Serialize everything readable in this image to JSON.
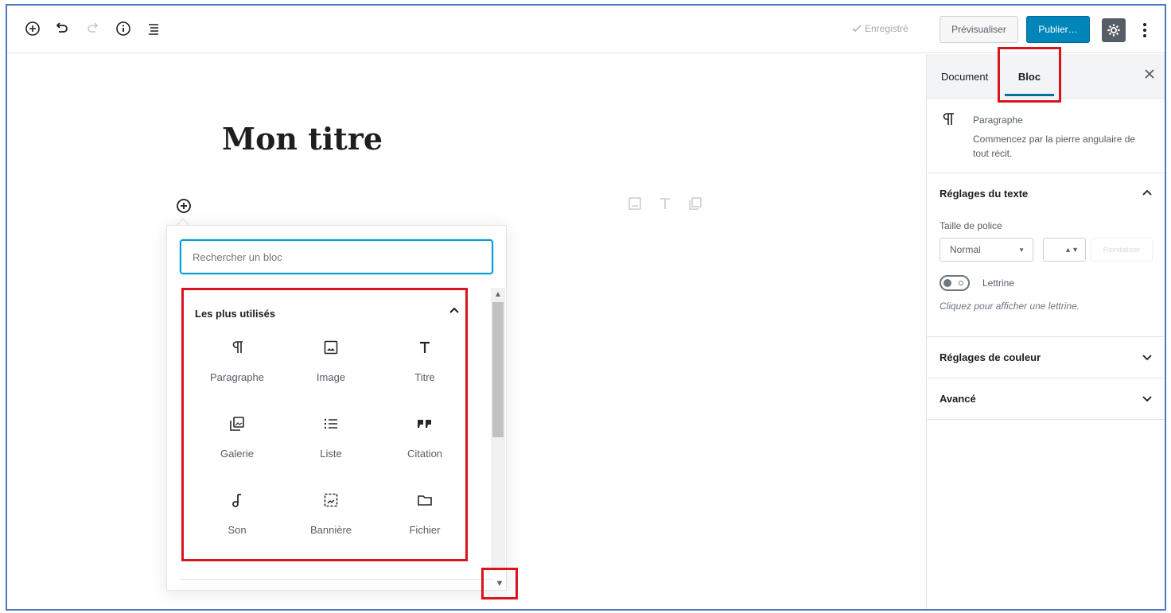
{
  "toolbar": {
    "add_icon": "plus-circle-icon",
    "undo_icon": "undo-icon",
    "redo_icon": "redo-icon",
    "info_icon": "info-icon",
    "outline_icon": "list-outline-icon",
    "saved_label": "Enregistré",
    "preview_label": "Prévisualiser",
    "publish_label": "Publier…",
    "settings_icon": "gear-icon",
    "more_icon": "vertical-ellipsis-icon"
  },
  "editor": {
    "post_title": "Mon titre",
    "hint_icons": [
      "image-icon",
      "heading-icon",
      "gallery-icon"
    ]
  },
  "inserter": {
    "search_placeholder": "Rechercher un bloc",
    "section_title": "Les plus utilisés",
    "blocks": [
      {
        "label": "Paragraphe",
        "icon": "paragraph-icon"
      },
      {
        "label": "Image",
        "icon": "image-icon"
      },
      {
        "label": "Titre",
        "icon": "heading-icon"
      },
      {
        "label": "Galerie",
        "icon": "gallery-icon"
      },
      {
        "label": "Liste",
        "icon": "list-icon"
      },
      {
        "label": "Citation",
        "icon": "quote-icon"
      },
      {
        "label": "Son",
        "icon": "audio-icon"
      },
      {
        "label": "Bannière",
        "icon": "cover-icon"
      },
      {
        "label": "Fichier",
        "icon": "folder-icon"
      }
    ]
  },
  "sidebar": {
    "tabs": {
      "document": "Document",
      "bloc": "Bloc"
    },
    "active_tab": "Bloc",
    "block_card": {
      "title": "Paragraphe",
      "description": "Commencez par la pierre angulaire de tout récit."
    },
    "text_settings": {
      "title": "Réglages du texte",
      "font_size_label": "Taille de police",
      "font_size_value": "Normal",
      "reset_label": "Réinitialiser",
      "drop_cap_label": "Lettrine",
      "drop_cap_help": "Cliquez pour afficher une lettrine."
    },
    "color_settings": {
      "title": "Réglages de couleur"
    },
    "advanced": {
      "title": "Avancé"
    }
  },
  "colors": {
    "accent": "#0085ba",
    "highlight": "#d9141b",
    "frame": "#4a78c2"
  }
}
